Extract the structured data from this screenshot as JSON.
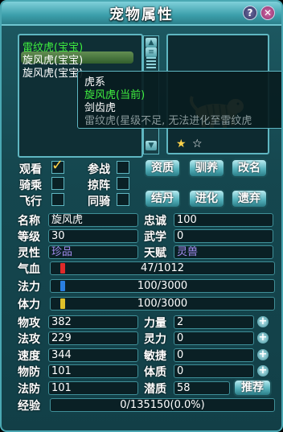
{
  "window": {
    "title": "宠物属性"
  },
  "pet_list": {
    "items": [
      {
        "label": "雷纹虎(宝宝)",
        "selected": true
      },
      {
        "label": "旋风虎(宝宝)",
        "selected": false
      },
      {
        "label": "旋风虎(宝宝)",
        "selected": false
      }
    ]
  },
  "tooltip": {
    "lines": [
      {
        "text": "虎系",
        "color": "#ffffff"
      },
      {
        "text": "旋风虎(当前)",
        "color": "#3ff03f"
      },
      {
        "text": "剑齿虎",
        "color": "#ffffff"
      },
      {
        "text": "雷纹虎(星级不足, 无法进化至雷纹虎",
        "color": "#8a9a9c"
      }
    ]
  },
  "checks": {
    "watch": "观看",
    "watch_checked": true,
    "fight": "参战",
    "ride": "骑乘",
    "formation": "掠阵",
    "fly": "飞行",
    "coride": "同骑"
  },
  "buttons": {
    "aptitude": "资质",
    "raise": "驯养",
    "rename": "改名",
    "pill": "结丹",
    "evolve": "进化",
    "release": "遗弃",
    "recommend": "推荐"
  },
  "info": {
    "name_label": "名称",
    "name": "旋风虎",
    "loyalty_label": "忠诚",
    "loyalty": "100",
    "level_label": "等级",
    "level": "30",
    "martial_label": "武学",
    "martial": "0",
    "spirit_label": "灵性",
    "spirit": "珍品",
    "talent_label": "天赋",
    "talent": "灵兽"
  },
  "bars": {
    "hp_label": "气血",
    "hp": "47/1012",
    "hp_ratio": 0.046,
    "mp_label": "法力",
    "mp": "100/3000",
    "mp_ratio": 0.033,
    "sp_label": "体力",
    "sp": "100/3000",
    "sp_ratio": 0.033
  },
  "stats": {
    "patk_label": "物攻",
    "patk": "382",
    "str_label": "力量",
    "str": "2",
    "matk_label": "法攻",
    "matk": "229",
    "spi_label": "灵力",
    "spi": "0",
    "spd_label": "速度",
    "spd": "344",
    "agi_label": "敏捷",
    "agi": "0",
    "pdef_label": "物防",
    "pdef": "101",
    "con_label": "体质",
    "con": "0",
    "mdef_label": "法防",
    "mdef": "101",
    "pot_label": "潜质",
    "pot": "58"
  },
  "exp": {
    "label": "经验",
    "value": "0/135150(0.0%)"
  },
  "stars": {
    "filled": 1,
    "total": 2
  },
  "colors": {
    "accent": "#4aa8b3",
    "selected": "#3ff03f",
    "purple": "#a48df0"
  }
}
